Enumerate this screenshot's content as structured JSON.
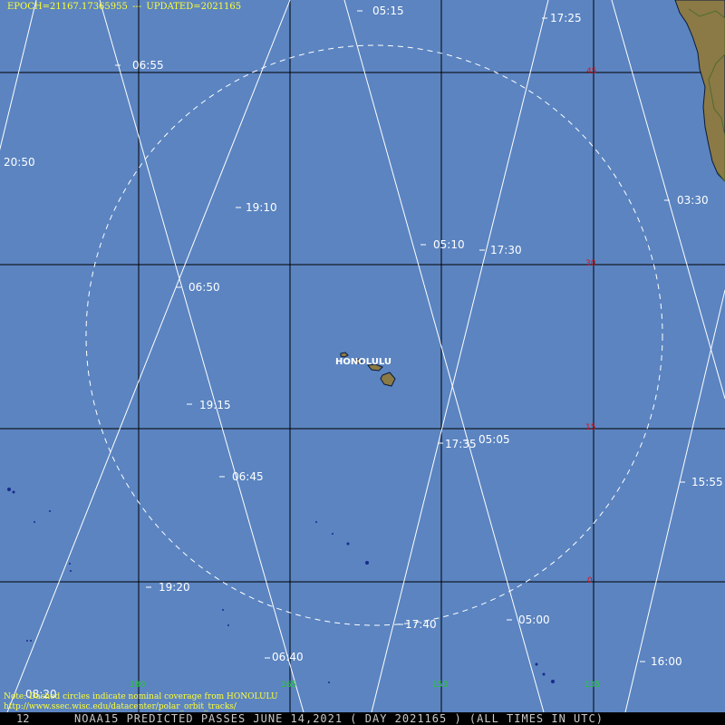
{
  "header": {
    "epoch": "EPOCH=21167.17365955",
    "sep": "---",
    "updated": "UPDATED=2021165"
  },
  "note": {
    "line1": "Note: Dashed circles indicate nominal coverage from HONOLULU",
    "line2": "http://www.ssec.wisc.edu/datacenter/polar_orbit_tracks/"
  },
  "footer": {
    "left": "12",
    "title": "NOAA15 PREDICTED PASSES JUNE 14,2021 ( DAY 2021165 ) (ALL TIMES IN UTC)"
  },
  "city": {
    "name": "HONOLULU"
  },
  "latitude_labels": [
    "45",
    "30",
    "15",
    "0"
  ],
  "longitude_labels": [
    "180",
    "165",
    "150",
    "135"
  ],
  "time_labels": [
    "05:15",
    "17:25",
    "06:55",
    "20:50",
    "03:30",
    "19:10",
    "05:10",
    "17:30",
    "06:50",
    "19:15",
    "17:35",
    "05:05",
    "06:45",
    "15:55",
    "19:20",
    "05:00",
    "17:40",
    "06:40",
    "16:00",
    "08:20"
  ],
  "colors": {
    "ocean": "#5b84c1",
    "land": "#8b7a45",
    "track": "#ffffff",
    "grid": "#000000",
    "header_text": "#ffff33",
    "latitude_text": "#e01010",
    "longitude_text": "#22cc22"
  }
}
